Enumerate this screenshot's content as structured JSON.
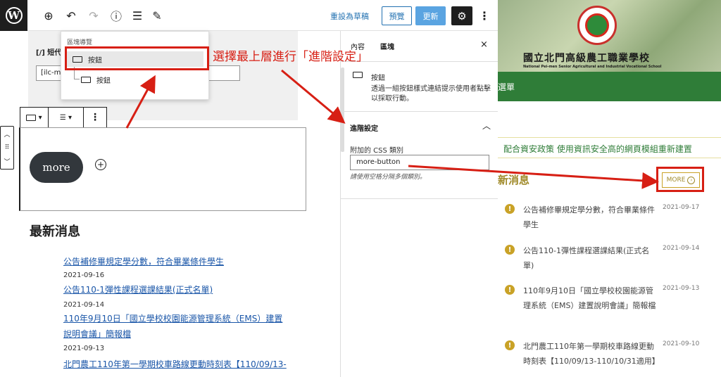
{
  "topbar": {
    "logo_letter": "W",
    "draft_label": "重設為草稿",
    "preview_label": "預覽",
    "update_label": "更新"
  },
  "editor": {
    "shortcode_title": "[/] 短代碼",
    "shortcode_value": "[ilc-ma",
    "more_button_text": "more",
    "news_heading": "最新消息",
    "news": [
      {
        "title": "公告補修畢規定學分數，符合畢業條件學生",
        "date": "2021-09-16"
      },
      {
        "title": "公告110-1彈性課程選課結果(正式名單)",
        "date": "2021-09-14"
      },
      {
        "title_line1": "110年9月10日「國立學校校園能源管理系統（EMS）建置",
        "title_line2": "說明會議」簡報檔",
        "date": "2021-09-13"
      },
      {
        "title": "北門農工110年第一學期校車路線更動時刻表【110/09/13-"
      }
    ]
  },
  "listview": {
    "title": "區塊導覽",
    "item1": "按鈕",
    "item2": "按鈕"
  },
  "sidebar": {
    "tab_post": "內容",
    "tab_block": "區塊",
    "close": "×",
    "block_name": "按鈕",
    "block_desc": "透過一組按鈕樣式連結提示使用者點擊以採取行動。",
    "advanced_title": "進階設定",
    "css_label": "附加的 CSS 類別",
    "css_value": "more-button",
    "css_hint": "請使用空格分隔多個類別。"
  },
  "site": {
    "school_zh": "國立北門高級農工職業學校",
    "school_en": "National Pei-men Senior Agricultural and Industrial Vocational School",
    "nav_text": "選單",
    "marquee": "配合資安政策 使用資訊安全高的網頁模組重新建置",
    "news_title": "新消息",
    "more_label": "MORE",
    "items": [
      {
        "text": "公告補修畢規定學分數，符合畢業條件學生",
        "date": "2021-09-17"
      },
      {
        "text": "公告110-1彈性課程選課結果(正式名單)",
        "date": "2021-09-14"
      },
      {
        "text": "110年9月10日「國立學校校園能源管理系統（EMS）建置說明會議」簡報檔",
        "date": "2021-09-13"
      },
      {
        "text": "北門農工110年第一學期校車路線更動時刻表【110/09/13-110/10/31適用】",
        "date": "2021-09-10"
      }
    ]
  },
  "annotation": {
    "text": "選擇最上層進行「進階設定」",
    "color": "#d71f14"
  }
}
